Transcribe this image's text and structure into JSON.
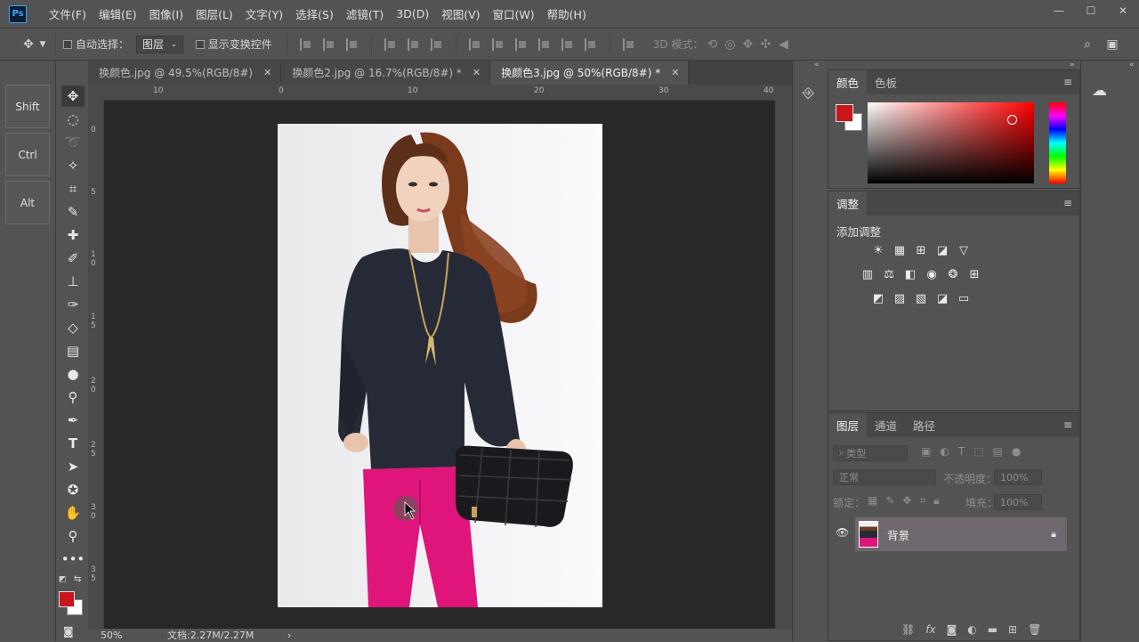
{
  "app": {
    "logo": "Ps"
  },
  "menu": [
    "文件(F)",
    "编辑(E)",
    "图像(I)",
    "图层(L)",
    "文字(Y)",
    "选择(S)",
    "滤镜(T)",
    "3D(D)",
    "视图(V)",
    "窗口(W)",
    "帮助(H)"
  ],
  "window_controls": {
    "minimize": "—",
    "maximize": "☐",
    "close": "✕"
  },
  "options": {
    "auto_select_label": "自动选择：",
    "auto_select_value": "图层",
    "show_transform_label": "显示变换控件",
    "mode_3d_label": "3D 模式："
  },
  "shortcuts": [
    "Shift",
    "Ctrl",
    "Alt"
  ],
  "tabs": [
    {
      "label": "换颜色.jpg @ 49.5%(RGB/8#)",
      "close": "✕"
    },
    {
      "label": "换颜色2.jpg @ 16.7%(RGB/8#) *",
      "close": "✕"
    },
    {
      "label": "换颜色3.jpg @ 50%(RGB/8#) *",
      "close": "✕"
    }
  ],
  "ruler": {
    "top": [
      "10",
      "0",
      "10",
      "20",
      "30",
      "40"
    ],
    "left": [
      "0",
      "5",
      "1 0",
      "1 5",
      "2 0",
      "2 5",
      "3 0",
      "3 5"
    ]
  },
  "status": {
    "zoom": "50%",
    "doc_info": "文档:2.27M/2.27M",
    "arrow": "›"
  },
  "color_panel": {
    "tabs": [
      "颜色",
      "色板"
    ],
    "foreground": "#c8161d",
    "background": "#ffffff"
  },
  "adjust_panel": {
    "tab": "调整",
    "add_label": "添加调整"
  },
  "layers_panel": {
    "tabs": [
      "图层",
      "通道",
      "路径"
    ],
    "filter_placeholder": "类型",
    "blend_mode": "正常",
    "opacity_label": "不透明度：",
    "opacity_value": "100%",
    "lock_label": "锁定：",
    "fill_label": "填充：",
    "fill_value": "100%",
    "layer_name": "背景"
  },
  "colors": {
    "accent_red": "#c8161d",
    "ps_blue": "#31a8ff"
  }
}
